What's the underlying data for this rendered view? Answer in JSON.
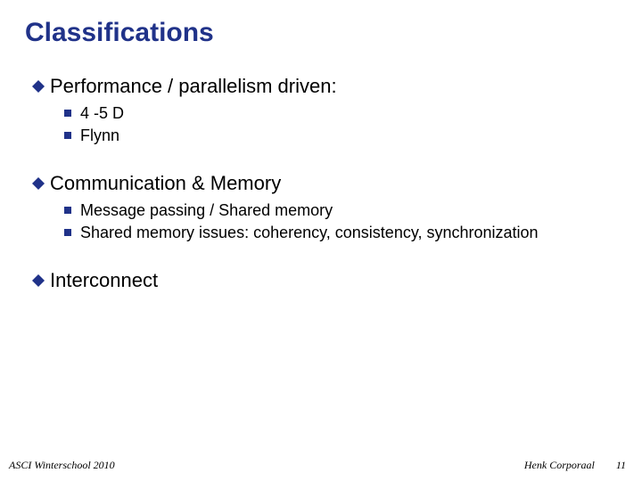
{
  "title": "Classifications",
  "sections": [
    {
      "heading": "Performance / parallelism driven:",
      "items": [
        "4 -5 D",
        "Flynn"
      ]
    },
    {
      "heading": "Communication & Memory",
      "items": [
        "Message passing / Shared memory",
        "Shared memory issues: coherency, consistency, synchronization"
      ]
    },
    {
      "heading": "Interconnect",
      "items": []
    }
  ],
  "footer": {
    "left": "ASCI Winterschool 2010",
    "right": "Henk Corporaal",
    "page": "11"
  },
  "colors": {
    "accent": "#203289"
  }
}
